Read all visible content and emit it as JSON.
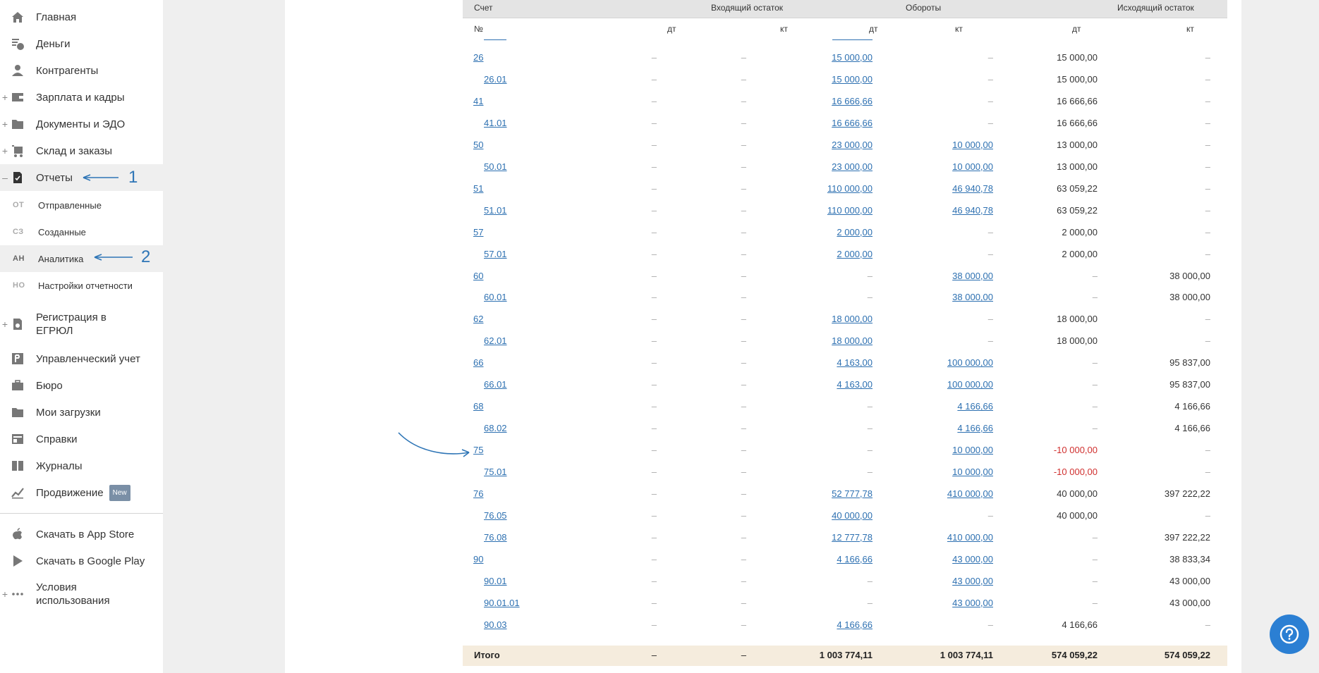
{
  "sidebar": {
    "items": [
      {
        "label": "Главная",
        "icon": "home-icon",
        "plus": ""
      },
      {
        "label": "Деньги",
        "icon": "money-icon",
        "plus": ""
      },
      {
        "label": "Контрагенты",
        "icon": "contractor-icon",
        "plus": ""
      },
      {
        "label": "Зарплата и кадры",
        "icon": "wallet-icon",
        "plus": "+"
      },
      {
        "label": "Документы и ЭДО",
        "icon": "folder-icon",
        "plus": "+"
      },
      {
        "label": "Склад и заказы",
        "icon": "cart-icon",
        "plus": "+"
      },
      {
        "label": "Отчеты",
        "icon": "report-icon",
        "plus": "–"
      }
    ],
    "subitems": [
      {
        "abbr": "ОТ",
        "label": "Отправленные"
      },
      {
        "abbr": "СЗ",
        "label": "Созданные"
      },
      {
        "abbr": "АН",
        "label": "Аналитика"
      },
      {
        "abbr": "НО",
        "label": "Настройки отчетности"
      }
    ],
    "items2": [
      {
        "label": "Регистрация в",
        "label2": "ЕГРЮЛ",
        "icon": "registration-icon",
        "plus": "+"
      },
      {
        "label": "Управленческий учет",
        "icon": "management-icon",
        "plus": ""
      },
      {
        "label": "Бюро",
        "icon": "briefcase-icon",
        "plus": ""
      },
      {
        "label": "Мои загрузки",
        "icon": "folder-icon",
        "plus": ""
      },
      {
        "label": "Справки",
        "icon": "reference-icon",
        "plus": ""
      },
      {
        "label": "Журналы",
        "icon": "journal-icon",
        "plus": ""
      },
      {
        "label": "Продвижение",
        "icon": "promotion-icon",
        "plus": "",
        "badge": "New"
      }
    ],
    "footer": [
      {
        "label": "Скачать в App Store",
        "icon": "apple-icon"
      },
      {
        "label": "Скачать в Google Play",
        "icon": "google-play-icon"
      },
      {
        "label": "Условия",
        "label2": "использования",
        "icon": "more-icon",
        "plus": "+"
      }
    ],
    "annotations": {
      "one": "1",
      "two": "2"
    }
  },
  "table": {
    "headers": {
      "account": "Счет",
      "opening": "Входящий остаток",
      "turnover": "Обороты",
      "closing": "Исходящий остаток",
      "no": "№",
      "dt": "дт",
      "kt": "кт"
    },
    "dash": "–",
    "rows": [
      {
        "acc": "26",
        "sub": false,
        "tdt": "15 000,00",
        "tkt": "",
        "cdt": "15 000,00",
        "ckt": ""
      },
      {
        "acc": "26.01",
        "sub": true,
        "tdt": "15 000,00",
        "tkt": "",
        "cdt": "15 000,00",
        "ckt": ""
      },
      {
        "acc": "41",
        "sub": false,
        "tdt": "16 666,66",
        "tkt": "",
        "cdt": "16 666,66",
        "ckt": ""
      },
      {
        "acc": "41.01",
        "sub": true,
        "tdt": "16 666,66",
        "tkt": "",
        "cdt": "16 666,66",
        "ckt": ""
      },
      {
        "acc": "50",
        "sub": false,
        "tdt": "23 000,00",
        "tkt": "10 000,00",
        "cdt": "13 000,00",
        "ckt": ""
      },
      {
        "acc": "50.01",
        "sub": true,
        "tdt": "23 000,00",
        "tkt": "10 000,00",
        "cdt": "13 000,00",
        "ckt": ""
      },
      {
        "acc": "51",
        "sub": false,
        "tdt": "110 000,00",
        "tkt": "46 940,78",
        "cdt": "63 059,22",
        "ckt": ""
      },
      {
        "acc": "51.01",
        "sub": true,
        "tdt": "110 000,00",
        "tkt": "46 940,78",
        "cdt": "63 059,22",
        "ckt": ""
      },
      {
        "acc": "57",
        "sub": false,
        "tdt": "2 000,00",
        "tkt": "",
        "cdt": "2 000,00",
        "ckt": ""
      },
      {
        "acc": "57.01",
        "sub": true,
        "tdt": "2 000,00",
        "tkt": "",
        "cdt": "2 000,00",
        "ckt": ""
      },
      {
        "acc": "60",
        "sub": false,
        "tdt": "",
        "tkt": "38 000,00",
        "cdt": "",
        "ckt": "38 000,00"
      },
      {
        "acc": "60.01",
        "sub": true,
        "tdt": "",
        "tkt": "38 000,00",
        "cdt": "",
        "ckt": "38 000,00"
      },
      {
        "acc": "62",
        "sub": false,
        "tdt": "18 000,00",
        "tkt": "",
        "cdt": "18 000,00",
        "ckt": ""
      },
      {
        "acc": "62.01",
        "sub": true,
        "tdt": "18 000,00",
        "tkt": "",
        "cdt": "18 000,00",
        "ckt": ""
      },
      {
        "acc": "66",
        "sub": false,
        "tdt": "4 163,00",
        "tkt": "100 000,00",
        "cdt": "",
        "ckt": "95 837,00"
      },
      {
        "acc": "66.01",
        "sub": true,
        "tdt": "4 163,00",
        "tkt": "100 000,00",
        "cdt": "",
        "ckt": "95 837,00"
      },
      {
        "acc": "68",
        "sub": false,
        "tdt": "",
        "tkt": "4 166,66",
        "cdt": "",
        "ckt": "4 166,66"
      },
      {
        "acc": "68.02",
        "sub": true,
        "tdt": "",
        "tkt": "4 166,66",
        "cdt": "",
        "ckt": "4 166,66"
      },
      {
        "acc": "75",
        "sub": false,
        "tdt": "",
        "tkt": "10 000,00",
        "cdt": "-10 000,00",
        "ckt": "",
        "neg": true
      },
      {
        "acc": "75.01",
        "sub": true,
        "tdt": "",
        "tkt": "10 000,00",
        "cdt": "-10 000,00",
        "ckt": "",
        "neg": true
      },
      {
        "acc": "76",
        "sub": false,
        "tdt": "52 777,78",
        "tkt": "410 000,00",
        "cdt": "40 000,00",
        "ckt": "397 222,22"
      },
      {
        "acc": "76.05",
        "sub": true,
        "tdt": "40 000,00",
        "tkt": "",
        "cdt": "40 000,00",
        "ckt": ""
      },
      {
        "acc": "76.08",
        "sub": true,
        "tdt": "12 777,78",
        "tkt": "410 000,00",
        "cdt": "",
        "ckt": "397 222,22"
      },
      {
        "acc": "90",
        "sub": false,
        "tdt": "4 166,66",
        "tkt": "43 000,00",
        "cdt": "",
        "ckt": "38 833,34"
      },
      {
        "acc": "90.01",
        "sub": true,
        "tdt": "",
        "tkt": "43 000,00",
        "cdt": "",
        "ckt": "43 000,00"
      },
      {
        "acc": "90.01.01",
        "sub": true,
        "tdt": "",
        "tkt": "43 000,00",
        "cdt": "",
        "ckt": "43 000,00"
      },
      {
        "acc": "90.03",
        "sub": true,
        "tdt": "4 166,66",
        "tkt": "",
        "cdt": "4 166,66",
        "ckt": ""
      }
    ],
    "total": {
      "label": "Итого",
      "tdt": "1 003 774,11",
      "tkt": "1 003 774,11",
      "cdt": "574 059,22",
      "ckt": "574 059,22"
    }
  },
  "colors": {
    "link": "#2d70b1",
    "negative": "#d0302f",
    "accent": "#2b7fd3",
    "total_bg": "#f5ecdd"
  }
}
